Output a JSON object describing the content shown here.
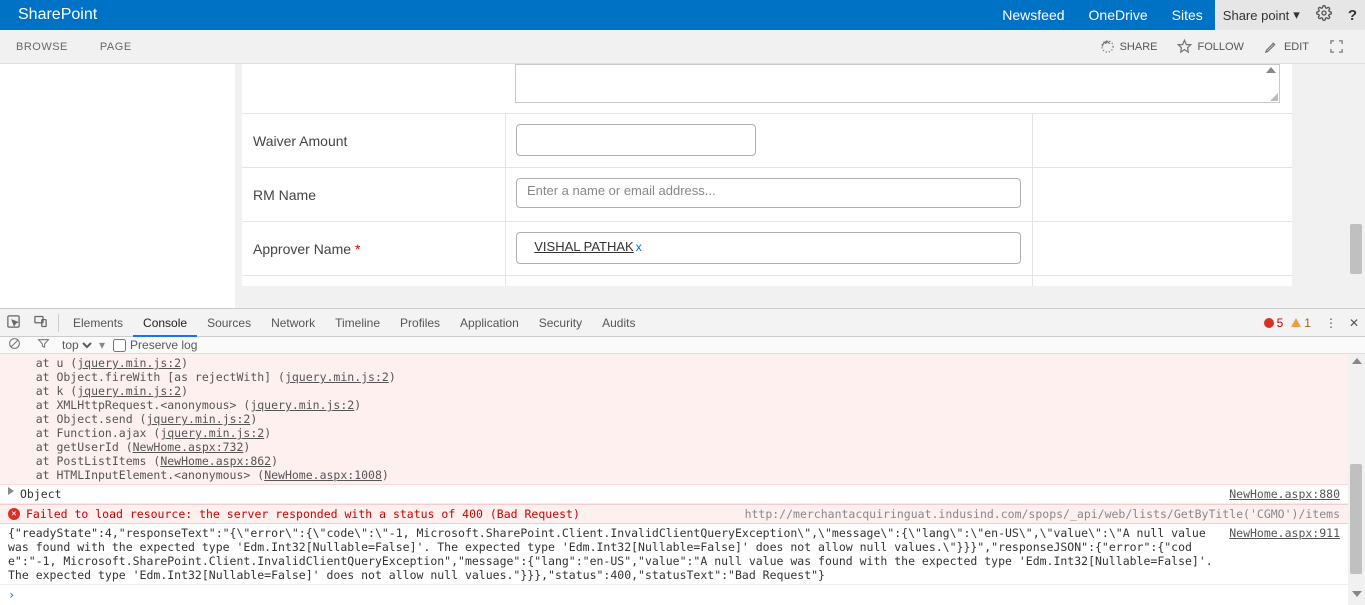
{
  "suite": {
    "brand": "SharePoint",
    "links": {
      "newsfeed": "Newsfeed",
      "onedrive": "OneDrive",
      "sites": "Sites"
    },
    "share": "Share point"
  },
  "ribbon": {
    "browse": "BROWSE",
    "page": "PAGE",
    "share": "SHARE",
    "follow": "FOLLOW",
    "edit": "EDIT"
  },
  "form": {
    "waiver_label": "Waiver Amount",
    "waiver_value": "",
    "rm_label": "RM Name",
    "rm_placeholder": "Enter a name or email address...",
    "approver_label": "Approver Name ",
    "approver_person": "VISHAL PATHAK",
    "approver_remove": "x"
  },
  "devtools": {
    "tabs": {
      "elements": "Elements",
      "console": "Console",
      "sources": "Sources",
      "network": "Network",
      "timeline": "Timeline",
      "profiles": "Profiles",
      "application": "Application",
      "security": "Security",
      "audits": "Audits"
    },
    "errors_count": "5",
    "warnings_count": "1",
    "sub": {
      "context": "top",
      "preserve": "Preserve log"
    },
    "stack": [
      {
        "pre": "    at u (",
        "lnk": "jquery.min.js:2",
        "post": ")"
      },
      {
        "pre": "    at Object.fireWith [as rejectWith] (",
        "lnk": "jquery.min.js:2",
        "post": ")"
      },
      {
        "pre": "    at k (",
        "lnk": "jquery.min.js:2",
        "post": ")"
      },
      {
        "pre": "    at XMLHttpRequest.<anonymous> (",
        "lnk": "jquery.min.js:2",
        "post": ")"
      },
      {
        "pre": "    at Object.send (",
        "lnk": "jquery.min.js:2",
        "post": ")"
      },
      {
        "pre": "    at Function.ajax (",
        "lnk": "jquery.min.js:2",
        "post": ")"
      },
      {
        "pre": "    at getUserId (",
        "lnk": "NewHome.aspx:732",
        "post": ")"
      },
      {
        "pre": "    at PostListItems (",
        "lnk": "NewHome.aspx:862",
        "post": ")"
      },
      {
        "pre": "    at HTMLInputElement.<anonymous> (",
        "lnk": "NewHome.aspx:1008",
        "post": ")"
      }
    ],
    "object_label": "Object",
    "object_src": "NewHome.aspx:880",
    "fail": {
      "msg": "Failed to load resource: the server responded with a status of 400 (Bad Request)",
      "src": "http://merchantacquiringuat.indusind.com/spops/_api/web/lists/GetByTitle('CGMO')/items"
    },
    "json_row": {
      "body": "{\"readyState\":4,\"responseText\":\"{\\\"error\\\":{\\\"code\\\":\\\"-1, Microsoft.SharePoint.Client.InvalidClientQueryException\\\",\\\"message\\\":{\\\"lang\\\":\\\"en-US\\\",\\\"value\\\":\\\"A null value was found with the expected type 'Edm.Int32[Nullable=False]'. The expected type 'Edm.Int32[Nullable=False]' does not allow null values.\\\"}}}\",\"responseJSON\":{\"error\":{\"code\":\"-1, Microsoft.SharePoint.Client.InvalidClientQueryException\",\"message\":{\"lang\":\"en-US\",\"value\":\"A null value was found with the expected type 'Edm.Int32[Nullable=False]'. The expected type 'Edm.Int32[Nullable=False]' does not allow null values.\"}}},\"status\":400,\"statusText\":\"Bad Request\"}",
      "src": "NewHome.aspx:911"
    }
  }
}
